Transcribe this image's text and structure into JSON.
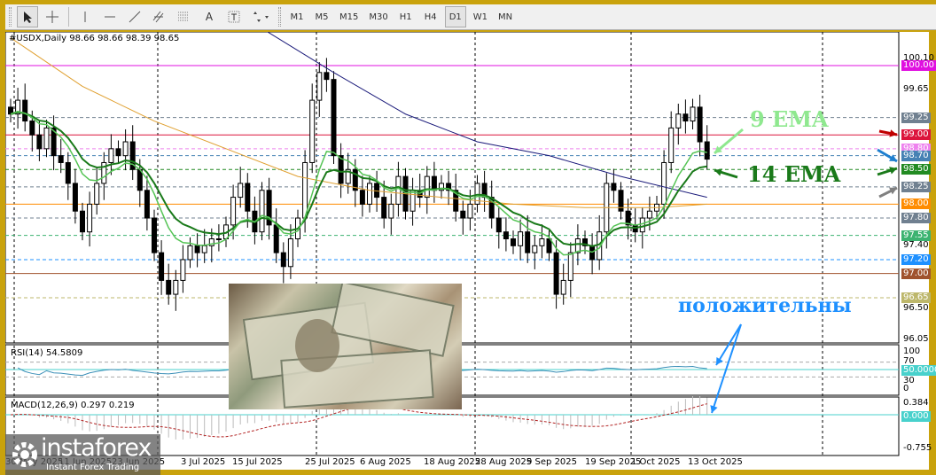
{
  "toolbar": {
    "tools": [
      "cursor-icon",
      "crosshair-icon",
      "vertical-line-icon",
      "horizontal-line-icon",
      "trendline-icon",
      "equidistant-channel-icon",
      "fibonacci-icon",
      "text-icon",
      "text-label-icon",
      "arrows-icon"
    ],
    "text_tool": "A",
    "timeframes": [
      "M1",
      "M5",
      "M15",
      "M30",
      "H1",
      "H4",
      "D1",
      "W1",
      "MN"
    ],
    "active_timeframe": "D1"
  },
  "chart_header": "#USDX,Daily  98.66 98.66 98.39 98.65",
  "indicators": {
    "rsi_label": "RSI(14) 54.5809",
    "rsi_ticks": [
      "100",
      "70",
      "30",
      "0"
    ],
    "rsi_level": "50.0000",
    "macd_label": "MACD(12,26,9) 0.297 0.219",
    "macd_ticks": [
      "0.384",
      "-0.755"
    ],
    "macd_zero": "0.000"
  },
  "annotations": {
    "ema9": "9 EMA",
    "ema14": "14 EMA",
    "positive": "положительны"
  },
  "logo": {
    "name": "instaforex",
    "tagline": "Instant Forex Trading"
  },
  "colors": {
    "frame": "#c9a20c",
    "ema9": "#55c455",
    "ema14": "#1a7a1a",
    "ma_slow": "#1a1a7a",
    "ma_mid": "#e0a030",
    "annotation_blue": "#1e90ff"
  },
  "chart_data": {
    "type": "candlestick",
    "symbol": "#USDX",
    "timeframe": "Daily",
    "ylim": [
      96.0,
      100.2
    ],
    "price_ticks": [
      "100.10",
      "99.65",
      "97.40",
      "96.50",
      "96.05"
    ],
    "levels": [
      {
        "price": 100.0,
        "label": "100.00",
        "color": "#e010e0",
        "style": "solid"
      },
      {
        "price": 99.25,
        "label": "99.25",
        "color": "#708090",
        "style": "dashed"
      },
      {
        "price": 99.0,
        "label": "99.00",
        "color": "#dc143c",
        "style": "solid"
      },
      {
        "price": 98.8,
        "label": "98.80",
        "color": "#ee82ee",
        "style": "dashed"
      },
      {
        "price": 98.7,
        "label": "98.70",
        "color": "#4682b4",
        "style": "dashed"
      },
      {
        "price": 98.5,
        "label": "98.50",
        "color": "#228b22",
        "style": "dashed"
      },
      {
        "price": 98.25,
        "label": "98.25",
        "color": "#708090",
        "style": "dashed"
      },
      {
        "price": 98.0,
        "label": "98.00",
        "color": "#ff8c00",
        "style": "solid"
      },
      {
        "price": 97.8,
        "label": "97.80",
        "color": "#708090",
        "style": "dashed"
      },
      {
        "price": 97.55,
        "label": "97.55",
        "color": "#3cb371",
        "style": "dashed"
      },
      {
        "price": 97.2,
        "label": "97.20",
        "color": "#1e90ff",
        "style": "dashed"
      },
      {
        "price": 97.0,
        "label": "97.00",
        "color": "#a0522d",
        "style": "solid"
      },
      {
        "price": 96.65,
        "label": "96.65",
        "color": "#bdb76b",
        "style": "dashed"
      }
    ],
    "date_labels": [
      "30 May 2025",
      "11 Jun 2025",
      "23 Jun 2025",
      "3 Jul 2025",
      "15 Jul 2025",
      "25 Jul 2025",
      "6 Aug 2025",
      "18 Aug 2025",
      "28 Aug 2025",
      "9 Sep 2025",
      "19 Sep 2025",
      "1 Oct 2025",
      "13 Oct 2025"
    ],
    "date_label_bars": [
      0,
      8,
      16,
      24,
      32,
      40,
      48,
      56,
      64,
      72,
      80,
      88,
      96
    ],
    "closes": [
      99.3,
      99.5,
      99.2,
      99.0,
      98.8,
      99.1,
      98.7,
      98.6,
      98.3,
      97.9,
      97.6,
      98.0,
      98.3,
      98.6,
      98.8,
      98.7,
      98.9,
      98.5,
      98.2,
      97.8,
      97.3,
      96.9,
      96.7,
      96.9,
      97.2,
      97.4,
      97.3,
      97.4,
      97.5,
      97.5,
      97.7,
      98.1,
      98.3,
      97.9,
      97.6,
      98.2,
      97.7,
      97.3,
      97.1,
      97.5,
      97.8,
      98.6,
      99.5,
      99.9,
      99.8,
      98.7,
      98.3,
      98.5,
      98.2,
      98.0,
      98.3,
      98.1,
      97.8,
      98.0,
      98.4,
      97.9,
      98.2,
      98.1,
      98.4,
      98.2,
      98.3,
      98.2,
      97.9,
      97.8,
      98.0,
      98.3,
      98.1,
      97.8,
      97.6,
      97.5,
      97.4,
      97.6,
      97.3,
      97.4,
      97.5,
      97.3,
      96.7,
      96.9,
      97.3,
      97.5,
      97.4,
      97.2,
      97.6,
      98.3,
      98.2,
      97.9,
      97.7,
      97.6,
      97.8,
      97.9,
      98.0,
      98.6,
      99.1,
      99.3,
      99.2,
      99.4,
      98.9,
      98.65
    ],
    "series": [
      {
        "name": "EMA 9",
        "color": "#55c455"
      },
      {
        "name": "EMA 14",
        "color": "#1a7a1a"
      },
      {
        "name": "MA slow",
        "color": "#1a1a7a",
        "points": [
          [
            34,
            100.6
          ],
          [
            45,
            99.9
          ],
          [
            55,
            99.3
          ],
          [
            65,
            98.9
          ],
          [
            75,
            98.7
          ],
          [
            85,
            98.4
          ],
          [
            97,
            98.1
          ]
        ]
      },
      {
        "name": "MA mid",
        "color": "#e0a030",
        "points": [
          [
            0,
            100.4
          ],
          [
            10,
            99.7
          ],
          [
            20,
            99.2
          ],
          [
            30,
            98.8
          ],
          [
            40,
            98.4
          ],
          [
            50,
            98.2
          ],
          [
            60,
            98.1
          ],
          [
            70,
            98.0
          ],
          [
            80,
            97.95
          ],
          [
            90,
            97.95
          ],
          [
            97,
            98.0
          ]
        ]
      }
    ]
  }
}
